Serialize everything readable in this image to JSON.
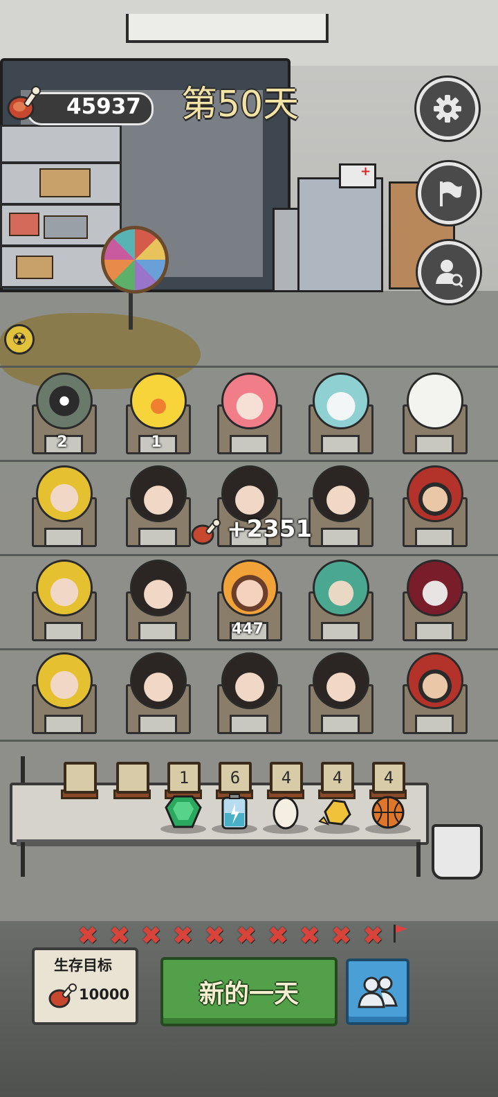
{
  "hud": {
    "meat_count": "45937",
    "day_title": "第50天"
  },
  "buttons": {
    "settings_icon": "gear-icon",
    "flag_icon": "flag-icon",
    "search_person_icon": "person-search-icon",
    "new_day_label": "新的一天",
    "people_icon": "people-icon"
  },
  "survivors": [
    {
      "row": 0,
      "col": 0,
      "type": "robot",
      "count": "2"
    },
    {
      "row": 0,
      "col": 1,
      "type": "duck",
      "count": "1"
    },
    {
      "row": 0,
      "col": 2,
      "type": "pink-hair-girl",
      "count": ""
    },
    {
      "row": 0,
      "col": 3,
      "type": "cyan-cat",
      "count": ""
    },
    {
      "row": 0,
      "col": 4,
      "type": "paper-note",
      "count": ""
    },
    {
      "row": 1,
      "col": 0,
      "type": "blond-vampire",
      "count": ""
    },
    {
      "row": 1,
      "col": 1,
      "type": "black-hair-girl",
      "count": ""
    },
    {
      "row": 1,
      "col": 2,
      "type": "black-hair-girl",
      "count": ""
    },
    {
      "row": 1,
      "col": 3,
      "type": "black-hair-girl",
      "count": ""
    },
    {
      "row": 1,
      "col": 4,
      "type": "sunglasses-man",
      "count": ""
    },
    {
      "row": 2,
      "col": 0,
      "type": "blond-vampire",
      "count": ""
    },
    {
      "row": 2,
      "col": 1,
      "type": "black-hair-girl",
      "count": ""
    },
    {
      "row": 2,
      "col": 2,
      "type": "injured-boy",
      "count": "447"
    },
    {
      "row": 2,
      "col": 3,
      "type": "green-hat-elder",
      "count": ""
    },
    {
      "row": 2,
      "col": 4,
      "type": "red-hood-girl",
      "count": ""
    },
    {
      "row": 3,
      "col": 0,
      "type": "blond-vampire",
      "count": ""
    },
    {
      "row": 3,
      "col": 1,
      "type": "black-hair-girl",
      "count": ""
    },
    {
      "row": 3,
      "col": 2,
      "type": "black-hair-girl",
      "count": ""
    },
    {
      "row": 3,
      "col": 3,
      "type": "black-hair-girl",
      "count": ""
    },
    {
      "row": 3,
      "col": 4,
      "type": "sunglasses-man",
      "count": ""
    }
  ],
  "floating_gain": "+2351",
  "inventory": [
    {
      "label": "",
      "item": ""
    },
    {
      "label": "",
      "item": ""
    },
    {
      "label": "1",
      "item": "emerald-gem"
    },
    {
      "label": "6",
      "item": "battery"
    },
    {
      "label": "4",
      "item": "egg"
    },
    {
      "label": "4",
      "item": "gold-nugget"
    },
    {
      "label": "4",
      "item": "basketball"
    }
  ],
  "progress": {
    "completed_marks": 10,
    "mark_glyph": "✖",
    "end_icon": "flag-icon"
  },
  "goal": {
    "label": "生存目标",
    "value": "10000"
  },
  "colors": {
    "accent_green": "#53a04a",
    "accent_blue": "#4aa0d6",
    "day_title": "#f3e2a6",
    "progress_mark": "#d8443a"
  }
}
